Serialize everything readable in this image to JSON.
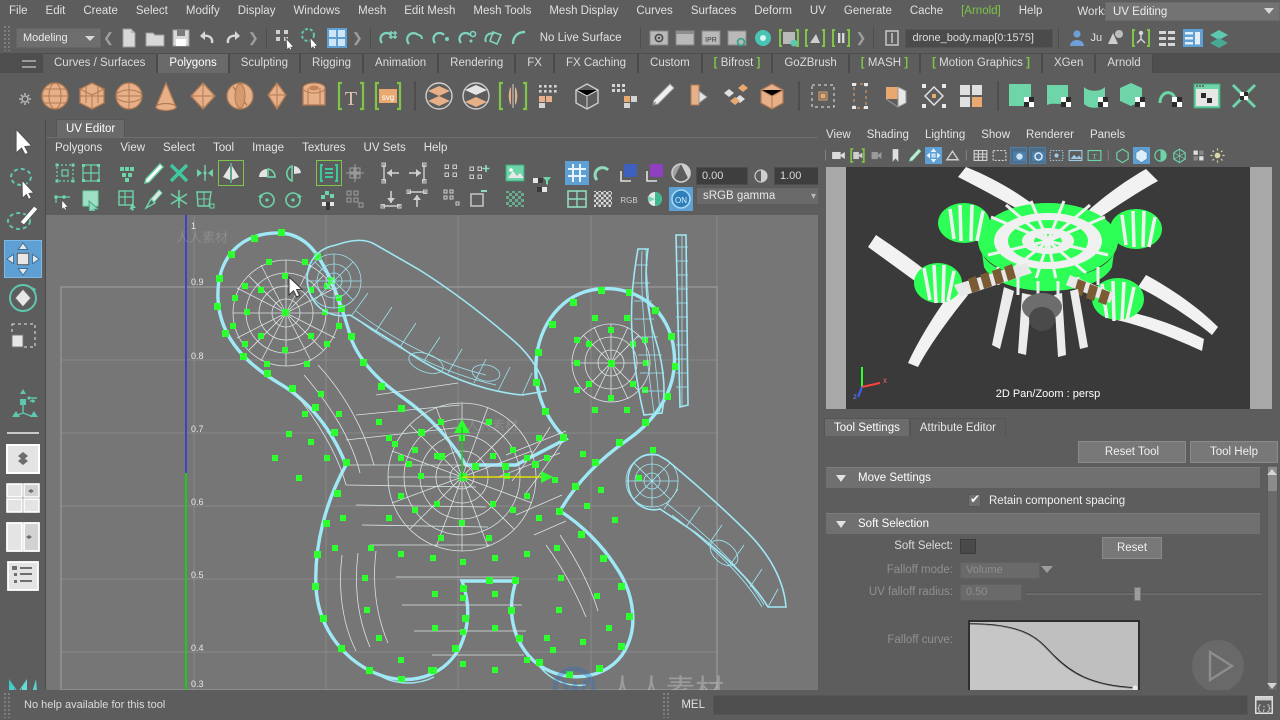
{
  "menubar": {
    "items": [
      "File",
      "Edit",
      "Create",
      "Select",
      "Modify",
      "Display",
      "Windows",
      "Mesh",
      "Edit Mesh",
      "Mesh Tools",
      "Mesh Display",
      "Curves",
      "Surfaces",
      "Deform",
      "UV",
      "Generate",
      "Cache",
      "Arnold",
      "Help"
    ],
    "arnold_item": "Arnold",
    "workspace_label": "Workspace :",
    "workspace_value": "UV Editing"
  },
  "statusbar": {
    "mode": "Modeling",
    "no_live_surface": "No Live Surface",
    "selection_field": "drone_body.map[0:1575]",
    "icons_file": [
      "new-scene-icon",
      "open-scene-icon",
      "save-scene-icon",
      "undo-icon",
      "redo-icon"
    ],
    "icons_select": [
      "select-by-hierarchy-icon",
      "select-by-object-icon",
      "select-by-component-icon"
    ],
    "icons_snap": [
      "snap-to-grid-icon",
      "snap-to-curve-icon",
      "snap-to-point-icon",
      "snap-to-projected-center-icon",
      "snap-to-view-plane-icon",
      "make-live-icon"
    ],
    "icons_render": [
      "render-current-frame-icon",
      "ipr-render-icon",
      "render-settings-icon",
      "hypershade-icon",
      "render-view-icon",
      "light-editor-icon",
      "rendering-flags-icon",
      "toggle-pause-icon"
    ],
    "icons_right": [
      "character-icon",
      "animation-layer-icon",
      "outliner-icon",
      "attribute-editor-icon",
      "channel-box-icon",
      "layer-editor-icon"
    ],
    "user_label": "Ju"
  },
  "shelf": {
    "tabs": [
      "Curves / Surfaces",
      "Polygons",
      "Sculpting",
      "Rigging",
      "Animation",
      "Rendering",
      "FX",
      "FX Caching",
      "Custom",
      "Bifrost",
      "GoZBrush",
      "MASH",
      "Motion Graphics",
      "XGen",
      "Arnold"
    ],
    "active_tab": "Polygons",
    "bracket_tabs": [
      "Bifrost",
      "MASH",
      "Motion Graphics"
    ],
    "icons": [
      "poly-sphere-icon",
      "poly-cube-icon",
      "poly-cylinder-icon",
      "poly-cone-icon",
      "poly-plane-icon",
      "poly-torus-icon",
      "poly-prism-icon",
      "poly-pipe-icon",
      "poly-type-icon",
      "poly-svg-icon",
      "combine-icon",
      "separate-icon",
      "mirror-icon",
      "poly-grid-icon",
      "smooth-icon",
      "quad-draw-icon",
      "multi-cut-icon",
      "target-weld-icon",
      "bevel-icon",
      "extrude-icon",
      "bridge-icon",
      "wedge-icon",
      "poly-merge-icon",
      "checker-plane-icon",
      "checker-cylinder-icon",
      "checker-curved-icon",
      "checker-cube-icon",
      "checker-spiral-icon",
      "uv-editor-icon",
      "uv-unfold-icon"
    ]
  },
  "toolbox": {
    "items": [
      "select-tool",
      "lasso-select-tool",
      "paint-select-tool",
      "move-tool",
      "rotate-tool",
      "scale-tool",
      "last-tool-used",
      "single-pane-layout",
      "four-pane-layout",
      "two-pane-layout",
      "outliner-persp-layout"
    ],
    "active": "move-tool",
    "logo": "maya-logo"
  },
  "uv_editor": {
    "panel_tab": "UV Editor",
    "menu": [
      "Polygons",
      "View",
      "Select",
      "Tool",
      "Image",
      "Textures",
      "UV Sets",
      "Help"
    ],
    "toolbar_row1": [
      "uv-lattice-icon",
      "uv-smear-icon",
      "move-uv-shell-icon",
      "uv-cut-icon",
      "uv-sew-icon",
      "uv-symmetry-icon",
      "uv-flip-icon",
      "uv-unfold-icon",
      "uv-layout-icon",
      "uv-normalize-icon",
      "uv-grid-icon",
      "align-left-icon",
      "align-right-icon",
      "uv-snap-icon",
      "uv-create-icon",
      "image-range-icon",
      "uv-filter-icon"
    ],
    "toolbar_row2": [
      "uv-select-shell-icon",
      "uv-select-connected-icon",
      "uv-grid-snap-icon",
      "uv-pin-icon",
      "uv-freeze-icon",
      "uv-distort-icon",
      "rotate-ccw-icon",
      "rotate-cw-icon",
      "uv-distribute-icon",
      "uv-straighten-icon",
      "align-bottom-icon",
      "align-top-icon",
      "uv-scatter-icon",
      "uv-rect-icon",
      "checker-pattern-icon"
    ],
    "highlighted_icons": [
      "uv-symmetry-icon",
      "uv-unfold-icon"
    ],
    "grid_toggle_icon": "grid-toggle-icon",
    "display_icons": [
      "uv-grid-display-icon",
      "uv-magnet-icon",
      "texture-border-icon",
      "image-blend-icon",
      "exposure-icon",
      "uv-checker-icon",
      "uv-checkerboard-icon",
      "rgb-icon",
      "color-channel-icon",
      "gamma-on-icon"
    ],
    "exposure_value": "0.00",
    "gamma_value": "1.00",
    "color_space": "sRGB gamma",
    "rgb_label": "RGB",
    "ruler_y": [
      "1",
      "0.9",
      "0.8",
      "0.7",
      "0.6",
      "0.5",
      "0.4",
      "0.3"
    ]
  },
  "viewport": {
    "menu": [
      "View",
      "Shading",
      "Lighting",
      "Show",
      "Renderer",
      "Panels"
    ],
    "label": "2D Pan/Zoom : persp",
    "icons": [
      "camera-icon",
      "camera-attributes-icon",
      "bookmark-icon",
      "grease-pencil-icon",
      "2d-pan-zoom-icon",
      "image-plane-icon",
      "grid-toggle-icon",
      "film-gate-icon",
      "resolution-gate-icon",
      "gate-mask-icon",
      "xray-icon",
      "xray-joints-icon",
      "texture-toggle-icon",
      "wireframe-icon",
      "smooth-shade-icon",
      "shadows-icon",
      "shaded-wireframe-icon",
      "xray-mode-icon",
      "lights-icon"
    ],
    "axis_labels": [
      "x",
      "y",
      "z"
    ]
  },
  "tool_settings": {
    "tabs": [
      "Tool Settings",
      "Attribute Editor"
    ],
    "active_tab": "Tool Settings",
    "reset_tool": "Reset Tool",
    "tool_help": "Tool Help",
    "sections": [
      {
        "title": "Move Settings",
        "rows": [
          {
            "type": "checkbox",
            "label": "Retain component spacing",
            "checked": true
          }
        ]
      },
      {
        "title": "Soft Selection",
        "rows": [
          {
            "type": "swatch",
            "label": "Soft Select:",
            "button": "Reset"
          },
          {
            "type": "dropdown",
            "label": "Falloff mode:",
            "value": "Volume",
            "disabled": true
          },
          {
            "type": "slider",
            "label": "UV falloff radius:",
            "value": "0.50",
            "disabled": true
          },
          {
            "type": "curve",
            "label": "Falloff curve:"
          }
        ]
      }
    ]
  },
  "statusline": {
    "help_text": "No help available for this tool",
    "mel_label": "MEL",
    "command_value": "",
    "script_editor_icon": "script-editor-icon"
  },
  "colors": {
    "bg": "#5d5d5d",
    "panel_bg": "#767676",
    "accent_blue": "#5e9fd4",
    "accent_green": "#7ec54a",
    "uv_edge": "#9fe8f5",
    "uv_vertex": "#2eff2e",
    "viewport_bg": "#3a3a3a",
    "text": "#e0e0e0"
  }
}
